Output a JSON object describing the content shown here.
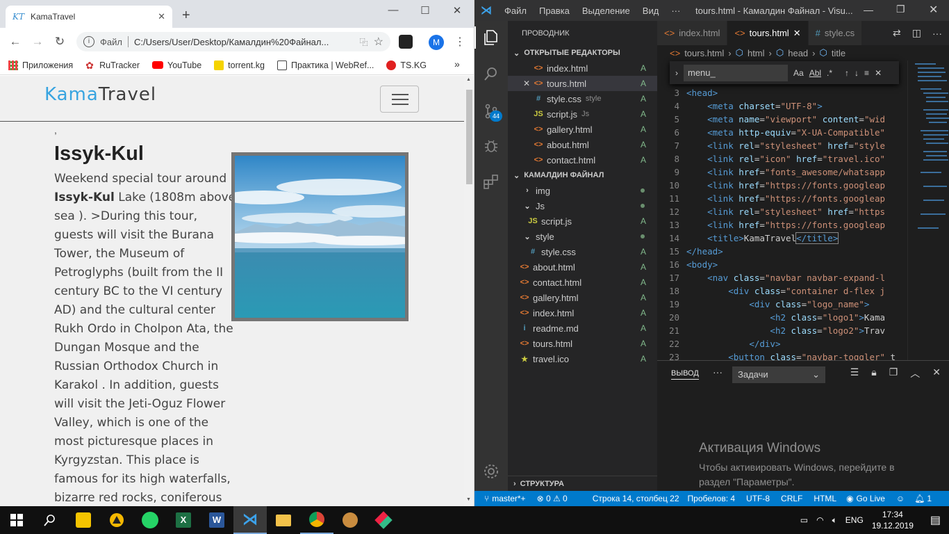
{
  "chrome": {
    "tab_title": "KamaTravel",
    "tab_favicon": "KT",
    "address_scheme": "Файл",
    "address_url": "C:/Users/User/Desktop/Камалдин%20Файнал...",
    "profile_initial": "M",
    "bookmarks": [
      "Приложения",
      "RuTracker",
      "YouTube",
      "torrent.kg",
      "Практика | WebRef...",
      "TS.KG"
    ],
    "page": {
      "logo_part1": "Kama",
      "logo_part2": "Travel",
      "stray_mark": ",",
      "tour_title": "Issyk-Kul",
      "tour_intro": "Weekend special tour around ",
      "tour_bold": "Issyk-Kul",
      "tour_body": " Lake (1808m above sea ). >During this tour, guests will visit the Burana Tower, the Museum of Petroglyphs (built from the II century BC to the VI century AD) and the cultural center Rukh Ordo in Cholpon Ata, the Dungan Mosque and the Russian Orthodox Church in Karakol . In addition, guests will visit the Jeti-Oguz Flower Valley, which is one of the most picturesque places in Kyrgyzstan. This place is famous for its high waterfalls, bizarre red rocks, coniferous forests and alpine meadows."
    }
  },
  "vscode": {
    "menus": [
      "Файл",
      "Правка",
      "Выделение",
      "Вид",
      "···"
    ],
    "window_title": "tours.html - Камалдин Файнал - Visu...",
    "scm_badge": "44",
    "explorer_title": "ПРОВОДНИК",
    "open_editors_title": "ОТКРЫТЫЕ РЕДАКТОРЫ",
    "open_editors": [
      {
        "icon": "<>",
        "name": "index.html",
        "extra": "",
        "status": "A"
      },
      {
        "icon": "<>",
        "name": "tours.html",
        "extra": "",
        "status": "A"
      },
      {
        "icon": "#",
        "name": "style.css",
        "extra": "style",
        "status": "A"
      },
      {
        "icon": "JS",
        "name": "script.js",
        "extra": "Js",
        "status": "A"
      },
      {
        "icon": "<>",
        "name": "gallery.html",
        "extra": "",
        "status": "A"
      },
      {
        "icon": "<>",
        "name": "about.html",
        "extra": "",
        "status": "A"
      },
      {
        "icon": "<>",
        "name": "contact.html",
        "extra": "",
        "status": "A"
      }
    ],
    "folder_title": "КАМАЛДИН ФАЙНАЛ",
    "tree": [
      {
        "icon": ">",
        "name": "img",
        "status": "dot"
      },
      {
        "icon": "v",
        "name": "Js",
        "status": "dot"
      },
      {
        "icon": "JS",
        "name": "script.js",
        "status": "A"
      },
      {
        "icon": "v",
        "name": "style",
        "status": "dot"
      },
      {
        "icon": "#",
        "name": "style.css",
        "status": "A"
      },
      {
        "icon": "<>",
        "name": "about.html",
        "status": "A"
      },
      {
        "icon": "<>",
        "name": "contact.html",
        "status": "A"
      },
      {
        "icon": "<>",
        "name": "gallery.html",
        "status": "A"
      },
      {
        "icon": "<>",
        "name": "index.html",
        "status": "A"
      },
      {
        "icon": "i",
        "name": "readme.md",
        "status": "A"
      },
      {
        "icon": "<>",
        "name": "tours.html",
        "status": "A"
      },
      {
        "icon": "★",
        "name": "travel.ico",
        "status": "A"
      }
    ],
    "outline_title": "СТРУКТУРА",
    "editor_tabs": [
      "index.html",
      "tours.html",
      "style.cs"
    ],
    "breadcrumbs": [
      "tours.html",
      "html",
      "head",
      "title"
    ],
    "find_text": "menu_",
    "find_opts": [
      "Aa",
      "Abl",
      ".*"
    ],
    "code_lines": [
      {
        "n": "3",
        "html": "<span class='t'>&lt;head&gt;</span>"
      },
      {
        "n": "4",
        "html": "    <span class='t'>&lt;meta</span> <span class='a'>charset</span>=<span class='s'>\"UTF-8\"</span><span class='t'>&gt;</span>"
      },
      {
        "n": "5",
        "html": "    <span class='t'>&lt;meta</span> <span class='a'>name</span>=<span class='s'>\"viewport\"</span> <span class='a'>content</span>=<span class='s'>\"wid</span>"
      },
      {
        "n": "6",
        "html": "    <span class='t'>&lt;meta</span> <span class='a'>http-equiv</span>=<span class='s'>\"X-UA-Compatible\"</span>"
      },
      {
        "n": "7",
        "html": "    <span class='t'>&lt;link</span> <span class='a'>rel</span>=<span class='s'>\"stylesheet\"</span> <span class='a'>href</span>=<span class='s'>\"style</span>"
      },
      {
        "n": "8",
        "html": "    <span class='t'>&lt;link</span> <span class='a'>rel</span>=<span class='s'>\"icon\"</span> <span class='a'>href</span>=<span class='s'>\"travel.ico\"</span>"
      },
      {
        "n": "9",
        "html": "    <span class='t'>&lt;link</span> <span class='a'>href</span>=<span class='s'>\"fonts_awesome/whatsapp</span>"
      },
      {
        "n": "10",
        "html": "    <span class='t'>&lt;link</span> <span class='a'>href</span>=<span class='s'>\"https://fonts.googleap</span>"
      },
      {
        "n": "11",
        "html": "    <span class='t'>&lt;link</span> <span class='a'>href</span>=<span class='s'>\"https://fonts.googleap</span>"
      },
      {
        "n": "12",
        "html": "    <span class='t'>&lt;link</span> <span class='a'>rel</span>=<span class='s'>\"stylesheet\"</span> <span class='a'>href</span>=<span class='s'>\"https</span>"
      },
      {
        "n": "13",
        "html": "    <span class='t'>&lt;link</span> <span class='a'>href</span>=<span class='s'>\"https://fonts.googleap</span>"
      },
      {
        "n": "14",
        "html": "    <span class='t'>&lt;title&gt;</span>KamaTravel<span class='t' style='outline:1px solid #888'>&lt;/title&gt;</span>"
      },
      {
        "n": "15",
        "html": "<span class='t'>&lt;/head&gt;</span>"
      },
      {
        "n": "16",
        "html": "<span class='t'>&lt;body&gt;</span>"
      },
      {
        "n": "17",
        "html": "    <span class='t'>&lt;nav</span> <span class='a'>class</span>=<span class='s'>\"navbar navbar-expand-l</span>"
      },
      {
        "n": "18",
        "html": "        <span class='t'>&lt;div</span> <span class='a'>class</span>=<span class='s'>\"container d-flex j</span>"
      },
      {
        "n": "19",
        "html": "            <span class='t'>&lt;div</span> <span class='a'>class</span>=<span class='s'>\"logo_name\"</span><span class='t'>&gt;</span>"
      },
      {
        "n": "20",
        "html": "                <span class='t'>&lt;h2</span> <span class='a'>class</span>=<span class='s'>\"logo1\"</span><span class='t'>&gt;</span>Kama"
      },
      {
        "n": "21",
        "html": "                <span class='t'>&lt;h2</span> <span class='a'>class</span>=<span class='s'>\"logo2\"</span><span class='t'>&gt;</span>Trav"
      },
      {
        "n": "22",
        "html": "            <span class='t'>&lt;/div&gt;</span>"
      },
      {
        "n": "23",
        "html": "        <span class='t'>&lt;button</span> <span class='a'>class</span>=<span class='s'>\"navbar-toggler\"</span> t"
      }
    ],
    "panel_tab": "ВЫВОД",
    "panel_select": "Задачи",
    "activation_title": "Активация Windows",
    "activation_text": "Чтобы активировать Windows, перейдите в раздел \"Параметры\".",
    "status": {
      "branch": "master*+",
      "problems": "⊗ 0 ⚠ 0",
      "position": "Строка 14, столбец 22",
      "spaces": "Пробелов: 4",
      "encoding": "UTF-8",
      "eol": "CRLF",
      "language": "HTML",
      "golive": "Go Live",
      "bell": "1"
    }
  },
  "taskbar": {
    "apps": [
      "start",
      "search",
      "playpc",
      "app-yellow",
      "whatsapp",
      "excel",
      "word",
      "vscode",
      "explorer",
      "chrome",
      "paint",
      "git-tool"
    ],
    "lang": "ENG",
    "time": "17:34",
    "date": "19.12.2019"
  }
}
